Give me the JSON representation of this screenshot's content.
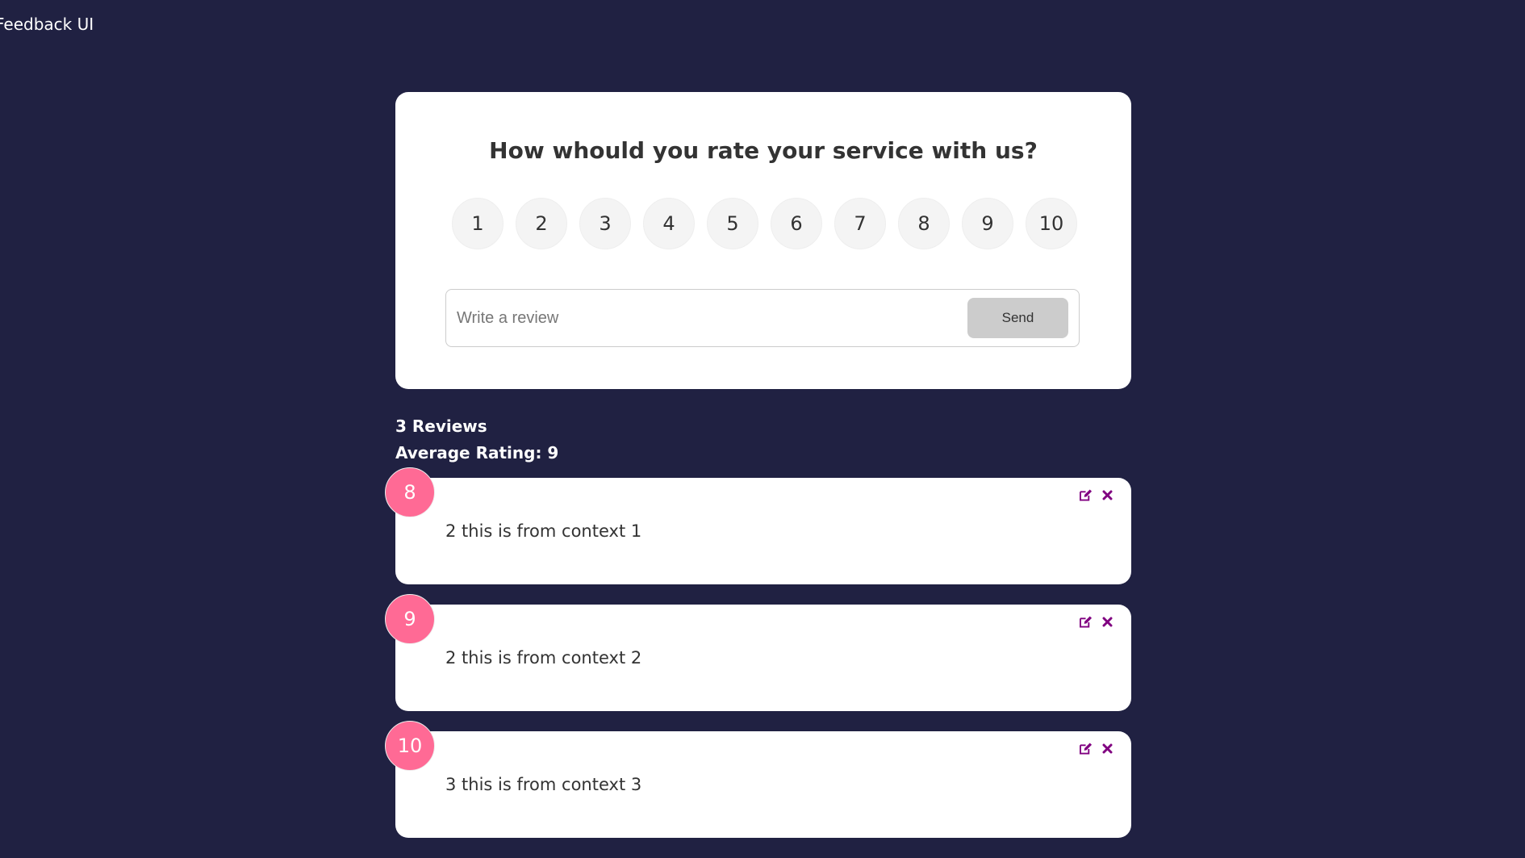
{
  "app": {
    "title": "Feedback UI"
  },
  "rating_form": {
    "question": "How whould you rate your service with us?",
    "options": [
      "1",
      "2",
      "3",
      "4",
      "5",
      "6",
      "7",
      "8",
      "9",
      "10"
    ],
    "input_placeholder": "Write a review",
    "send_label": "Send"
  },
  "stats": {
    "reviews_label": "3 Reviews",
    "average_label": "Average Rating: 9"
  },
  "reviews": [
    {
      "rating": "8",
      "text": "2 this is from context 1"
    },
    {
      "rating": "9",
      "text": "2 this is from context 2"
    },
    {
      "rating": "10",
      "text": "3 this is from context 3"
    }
  ],
  "colors": {
    "background": "#202142",
    "accent": "#ff6a95",
    "action_icon": "#800080"
  },
  "icons": {
    "edit": "edit-icon",
    "delete": "close-icon"
  }
}
